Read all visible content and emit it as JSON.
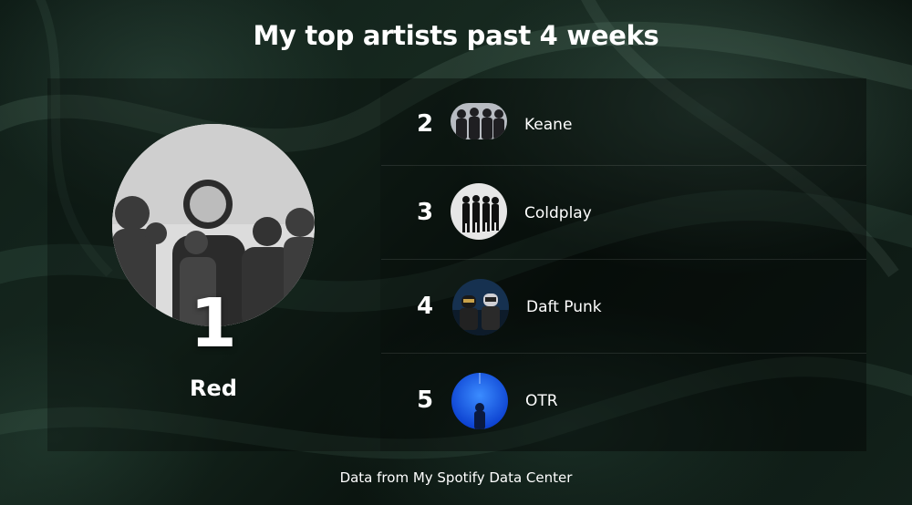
{
  "title": "My top artists past 4 weeks",
  "top_artist": {
    "rank": "1",
    "name": "Red"
  },
  "artists": [
    {
      "rank": "2",
      "name": "Keane"
    },
    {
      "rank": "3",
      "name": "Coldplay"
    },
    {
      "rank": "4",
      "name": "Daft Punk"
    },
    {
      "rank": "5",
      "name": "OTR"
    }
  ],
  "footer": "Data from My Spotify Data Center",
  "colors": {
    "background": "#13241c",
    "text": "#ffffff",
    "otr_accent": "#1e63f0"
  }
}
